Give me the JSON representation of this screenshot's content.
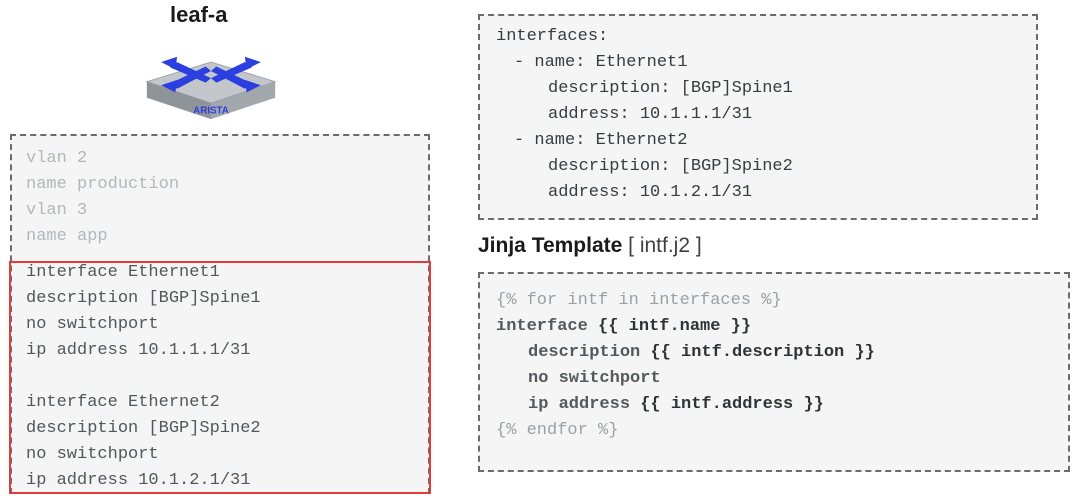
{
  "leaf": {
    "title": "leaf-a",
    "switch_vendor": "ARISTA",
    "vlan_config": {
      "vlans": [
        {
          "id": 2,
          "name": "production"
        },
        {
          "id": 3,
          "name": "app"
        }
      ],
      "lines": [
        "vlan 2",
        "   name production",
        "vlan 3",
        "   name app"
      ]
    },
    "intf_config": {
      "interfaces": [
        {
          "name": "Ethernet1",
          "description": "[BGP]Spine1",
          "no_switchport": true,
          "address": "10.1.1.1/31"
        },
        {
          "name": "Ethernet2",
          "description": "[BGP]Spine2",
          "no_switchport": true,
          "address": "10.1.2.1/31"
        }
      ],
      "lines": [
        "interface Ethernet1",
        "   description [BGP]Spine1",
        "   no switchport",
        "   ip address 10.1.1.1/31",
        "",
        "interface Ethernet2",
        "   description [BGP]Spine2",
        "   no switchport",
        "   ip address 10.1.2.1/31"
      ]
    }
  },
  "yaml": {
    "key": "interfaces:",
    "items": [
      {
        "dash": "- name: Ethernet1",
        "desc": "description: [BGP]Spine1",
        "addr": "address: 10.1.1.1/31"
      },
      {
        "dash": "- name: Ethernet2",
        "desc": "description: [BGP]Spine2",
        "addr": "address: 10.1.2.1/31"
      }
    ]
  },
  "jinja": {
    "heading_bold": "Jinja Template",
    "heading_thin": " [ intf.j2 ]",
    "for_open": "{% for intf in interfaces %}",
    "line_if_pre": "interface ",
    "line_if_var": "{{ intf.name }}",
    "line_desc_pre": "description ",
    "line_desc_var": "{{ intf.description }}",
    "line_nosw": "no switchport",
    "line_ip_pre": "ip address ",
    "line_ip_var": "{{ intf.address }}",
    "for_close": "{% endfor %}"
  }
}
